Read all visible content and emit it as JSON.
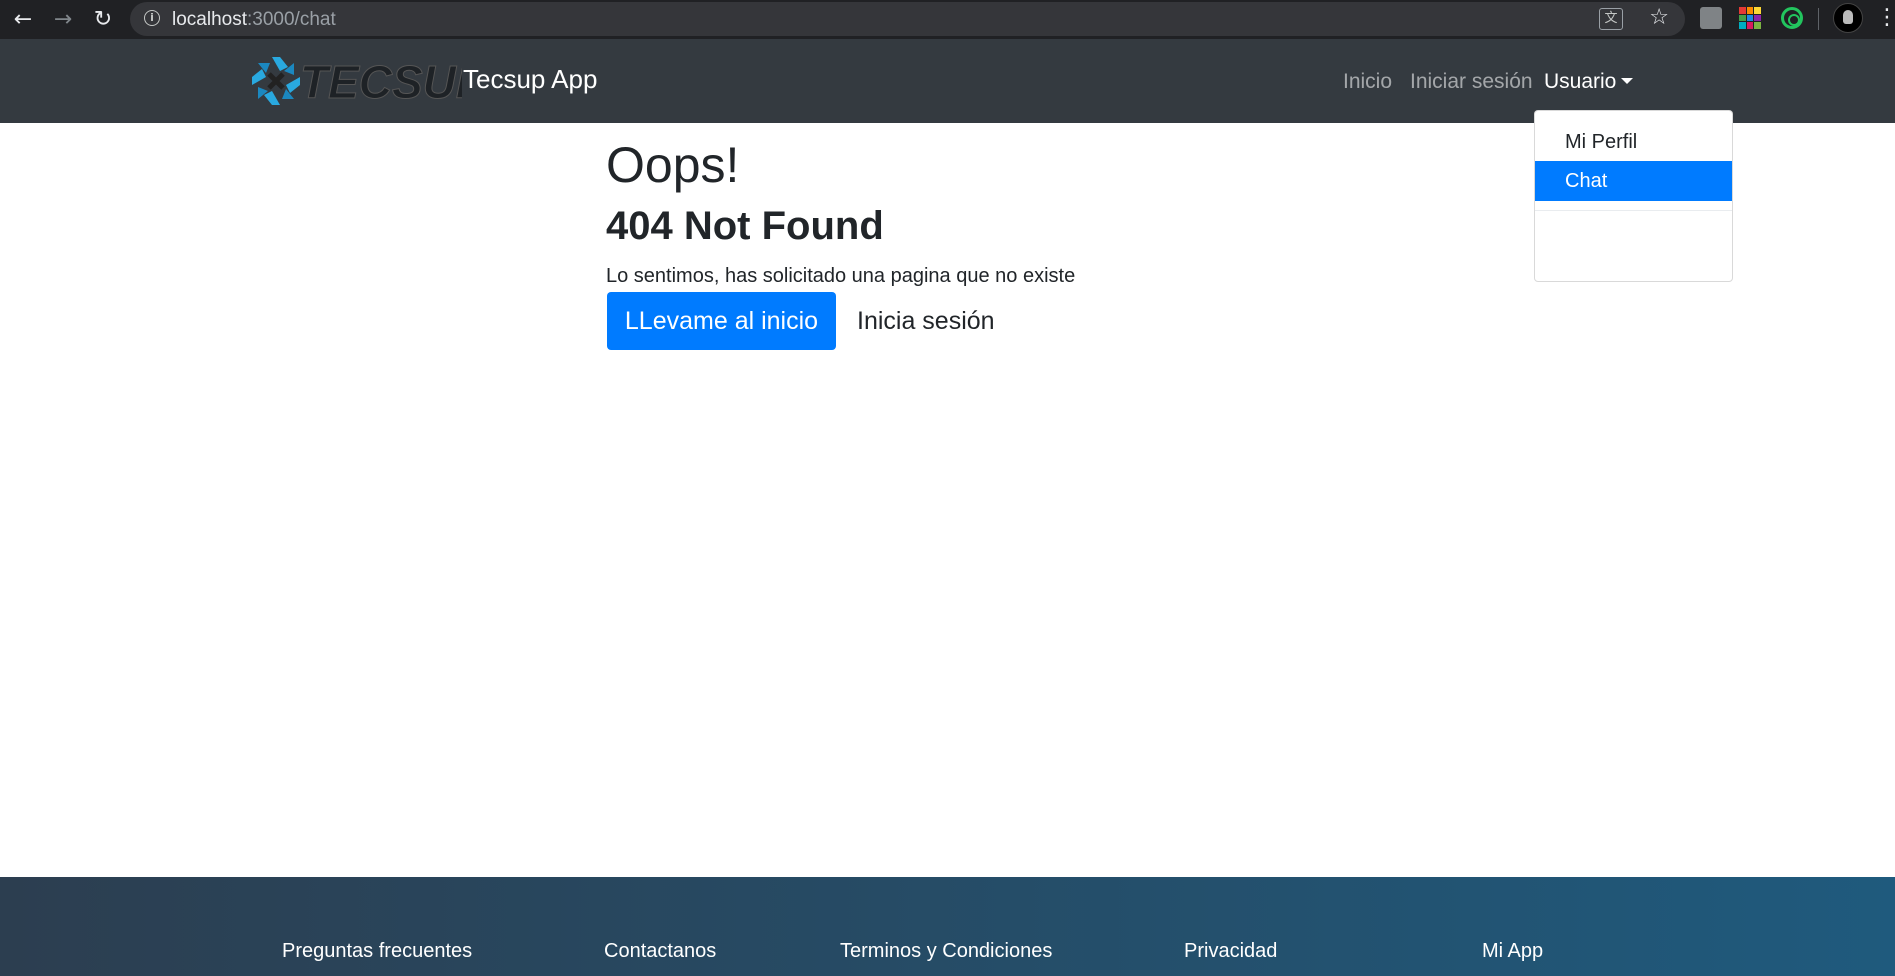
{
  "browser": {
    "url_host": "localhost",
    "url_path": ":3000/chat",
    "back_icon": "arrow-left-icon",
    "forward_icon": "arrow-right-icon",
    "reload_icon": "reload-icon"
  },
  "navbar": {
    "brand": "Tecsup App",
    "logo_text": "TECSUP",
    "links": {
      "home": "Inicio",
      "login": "Iniciar sesión",
      "user": "Usuario"
    }
  },
  "dropdown": {
    "items": [
      "Mi Perfil",
      "Chat"
    ],
    "active_index": 1
  },
  "main": {
    "title": "Oops!",
    "subtitle": "404 Not Found",
    "message": "Lo sentimos, has solicitado una pagina que no existe",
    "home_button": "LLevame al inicio",
    "login_link": "Inicia sesión"
  },
  "footer": {
    "links": [
      "Preguntas frecuentes",
      "Contactanos",
      "Terminos y Condiciones",
      "Privacidad",
      "Mi App"
    ]
  },
  "colors": {
    "primary": "#007bff",
    "navbar_bg": "#343a40",
    "footer_start": "#2c3e50",
    "footer_end": "#1f5a7d"
  }
}
